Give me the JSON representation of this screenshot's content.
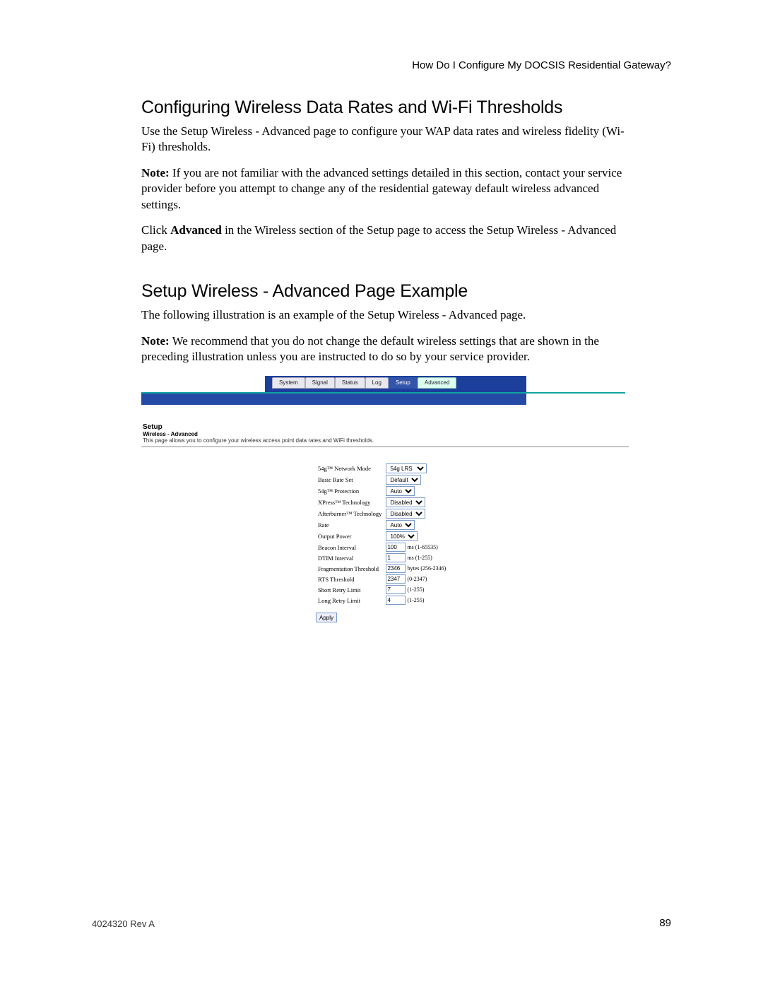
{
  "running_head": "How Do I Configure My DOCSIS Residential Gateway?",
  "sec1_title": "Configuring Wireless Data Rates and Wi-Fi Thresholds",
  "sec1_p1": "Use the Setup Wireless - Advanced page to configure your WAP data rates and wireless fidelity (Wi-Fi) thresholds.",
  "sec1_note_label": "Note:",
  "sec1_note_body": " If you are not familiar with the advanced settings detailed in this section, contact your service provider before you attempt to change any of the residential gateway default wireless advanced settings.",
  "sec1_p3a": "Click ",
  "sec1_p3b": "Advanced",
  "sec1_p3c": " in the Wireless section of the Setup page to access the Setup Wireless - Advanced page.",
  "sec2_title": "Setup Wireless - Advanced Page Example",
  "sec2_p1": "The following illustration is an example of the Setup Wireless - Advanced page.",
  "sec2_note_label": "Note:",
  "sec2_note_body": " We recommend that you do not change the default wireless settings that are shown in the preceding illustration unless you are instructed to do so by your service provider.",
  "ui": {
    "tabs": [
      "System",
      "Signal",
      "Status",
      "Log",
      "Setup",
      "Advanced"
    ],
    "active_tab_index": 4,
    "page_heading": "Setup",
    "page_sub": "Wireless - Advanced",
    "page_desc": "This page allows you to configure your wireless access point data rates and WiFi thresholds.",
    "rows": [
      {
        "label": "54g™ Network Mode",
        "type": "select",
        "value": "54g LRS"
      },
      {
        "label": "Basic Rate Set",
        "type": "select",
        "value": "Default"
      },
      {
        "label": "54g™ Protection",
        "type": "select",
        "value": "Auto"
      },
      {
        "label": "XPress™ Technology",
        "type": "select",
        "value": "Disabled"
      },
      {
        "label": "Afterburner™ Technology",
        "type": "select",
        "value": "Disabled"
      },
      {
        "label": "Rate",
        "type": "select",
        "value": "Auto"
      },
      {
        "label": "Output Power",
        "type": "select",
        "value": "100%"
      },
      {
        "label": "Beacon Interval",
        "type": "input",
        "value": "100",
        "hint": "ms (1-65535)"
      },
      {
        "label": "DTIM Interval",
        "type": "input",
        "value": "1",
        "hint": "ms (1-255)"
      },
      {
        "label": "Fragmentation Threshold",
        "type": "input",
        "value": "2346",
        "hint": "bytes (256-2346)"
      },
      {
        "label": "RTS Threshold",
        "type": "input",
        "value": "2347",
        "hint": "(0-2347)"
      },
      {
        "label": "Short Retry Limit",
        "type": "input",
        "value": "7",
        "hint": "(1-255)"
      },
      {
        "label": "Long Retry Limit",
        "type": "input",
        "value": "4",
        "hint": "(1-255)"
      }
    ],
    "apply_label": "Apply"
  },
  "footer_left": "4024320 Rev A",
  "footer_right": "89"
}
